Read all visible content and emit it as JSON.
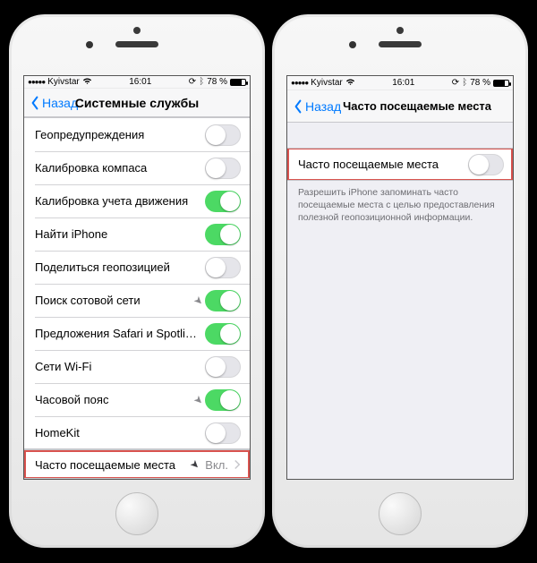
{
  "status": {
    "carrier": "Kyivstar",
    "time": "16:01",
    "battery_pct": "78 %"
  },
  "left": {
    "back_label": "Назад",
    "title": "Системные службы",
    "rows": [
      {
        "label": "Геопредупреждения",
        "type": "toggle",
        "on": false
      },
      {
        "label": "Калибровка компаса",
        "type": "toggle",
        "on": false
      },
      {
        "label": "Калибровка учета движения",
        "type": "toggle",
        "on": true
      },
      {
        "label": "Найти iPhone",
        "type": "toggle",
        "on": true
      },
      {
        "label": "Поделиться геопозицией",
        "type": "toggle",
        "on": false
      },
      {
        "label": "Поиск сотовой сети",
        "type": "toggle",
        "on": true,
        "arrow": true
      },
      {
        "label": "Предложения Safari и Spotli…",
        "type": "toggle",
        "on": true
      },
      {
        "label": "Сети Wi-Fi",
        "type": "toggle",
        "on": false
      },
      {
        "label": "Часовой пояс",
        "type": "toggle",
        "on": true,
        "arrow": true
      },
      {
        "label": "HomeKit",
        "type": "toggle",
        "on": false
      }
    ],
    "freq_row": {
      "label": "Часто посещаемые места",
      "detail": "Вкл."
    }
  },
  "right": {
    "back_label": "Назад",
    "title": "Часто посещаемые места",
    "row": {
      "label": "Часто посещаемые места",
      "on": false
    },
    "footer": "Разрешить iPhone запоминать часто посещаемые места с целью предоставления полезной геопозиционной информации."
  }
}
